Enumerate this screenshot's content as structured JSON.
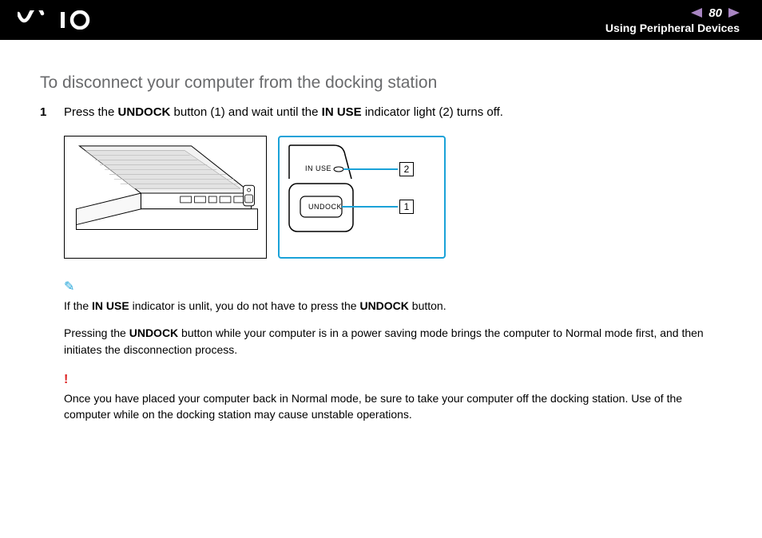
{
  "header": {
    "page_number": "80",
    "breadcrumb": "Using Peripheral Devices"
  },
  "section": {
    "title": "To disconnect your computer from the docking station"
  },
  "step1": {
    "number": "1",
    "prefix": "Press the ",
    "b1": "UNDOCK",
    "mid": " button (1) and wait until the ",
    "b2": "IN USE",
    "suffix": " indicator light (2) turns off."
  },
  "figure": {
    "label_in_use": "IN USE",
    "label_undock": "UNDOCK",
    "callout1": "1",
    "callout2": "2"
  },
  "note1": {
    "p1a": "If the ",
    "p1b": "IN USE",
    "p1c": " indicator is unlit, you do not have to press the ",
    "p1d": "UNDOCK",
    "p1e": " button.",
    "p2a": "Pressing the ",
    "p2b": "UNDOCK",
    "p2c": " button while your computer is in a power saving mode brings the computer to Normal mode first, and then initiates the disconnection process."
  },
  "warning": {
    "text": "Once you have placed your computer back in Normal mode, be sure to take your computer off the docking station. Use of the computer while on the docking station may cause unstable operations."
  }
}
